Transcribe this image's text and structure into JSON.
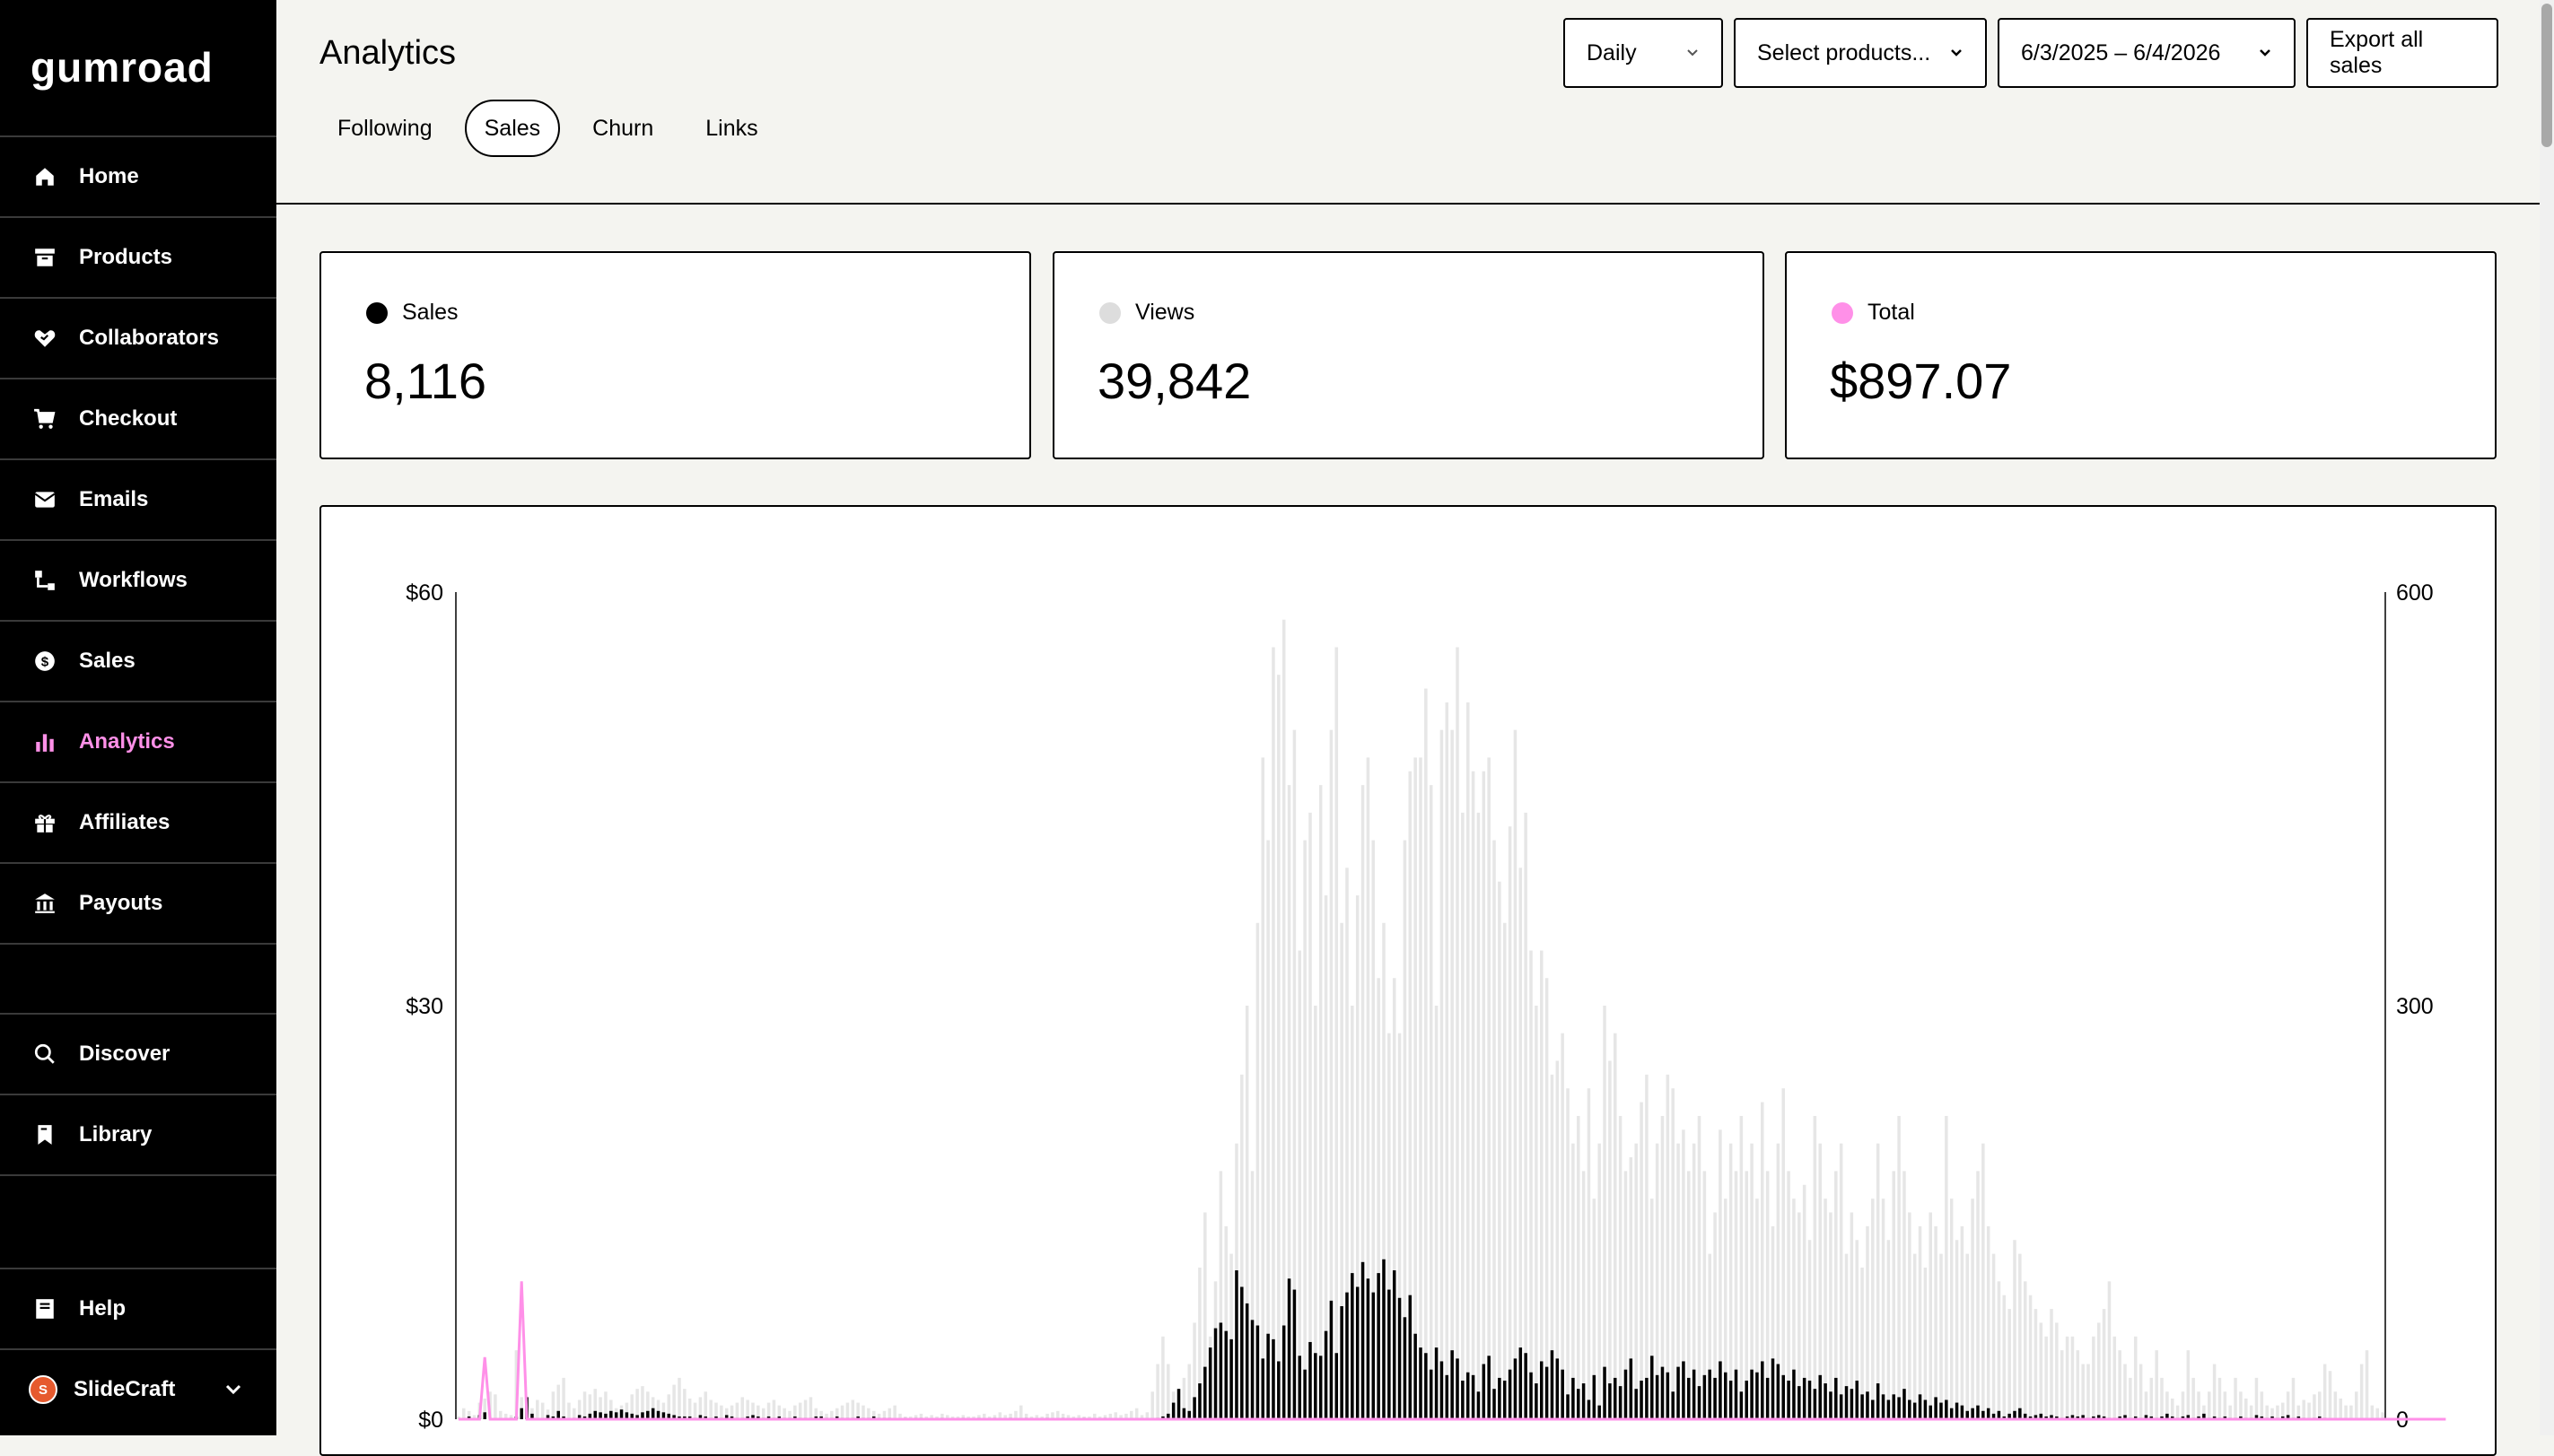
{
  "brand": {
    "logo_text": "gumroad"
  },
  "sidebar": {
    "items": [
      {
        "label": "Home",
        "icon": "home-icon"
      },
      {
        "label": "Products",
        "icon": "archive-icon"
      },
      {
        "label": "Collaborators",
        "icon": "handshake-icon"
      },
      {
        "label": "Checkout",
        "icon": "cart-icon"
      },
      {
        "label": "Emails",
        "icon": "envelope-icon"
      },
      {
        "label": "Workflows",
        "icon": "flow-icon"
      },
      {
        "label": "Sales",
        "icon": "dollar-circle-icon"
      },
      {
        "label": "Analytics",
        "icon": "bar-chart-icon",
        "active": true
      },
      {
        "label": "Affiliates",
        "icon": "gift-icon"
      },
      {
        "label": "Payouts",
        "icon": "bank-icon"
      }
    ],
    "secondary": [
      {
        "label": "Discover",
        "icon": "search-icon"
      },
      {
        "label": "Library",
        "icon": "bookmark-icon"
      }
    ],
    "help_label": "Help",
    "account": {
      "name": "SlideCraft",
      "avatar_letter": "S"
    }
  },
  "header": {
    "title": "Analytics",
    "tabs": [
      {
        "label": "Following",
        "active": false
      },
      {
        "label": "Sales",
        "active": true
      },
      {
        "label": "Churn",
        "active": false
      },
      {
        "label": "Links",
        "active": false
      }
    ],
    "interval_select": "Daily",
    "product_select": "Select products...",
    "date_range": "6/3/2025 – 6/4/2026",
    "export_label": "Export all sales"
  },
  "stats": [
    {
      "label": "Sales",
      "value": "8,116",
      "color": "#000000"
    },
    {
      "label": "Views",
      "value": "39,842",
      "color": "#dddddd"
    },
    {
      "label": "Total",
      "value": "$897.07",
      "color": "#ff90e8"
    }
  ],
  "colors": {
    "accent": "#ff90e8",
    "views": "#e6e6e6",
    "sales": "#000000"
  },
  "chart_data": {
    "type": "bar",
    "left_axis": {
      "ticks": [
        "$0",
        "$30",
        "$60"
      ],
      "ylim": [
        0,
        60
      ]
    },
    "right_axis": {
      "ticks": [
        "0",
        "300",
        "600"
      ],
      "ylim": [
        0,
        600
      ]
    },
    "x": "daily, 6/3/2025 – 6/4/2026 (367 days)",
    "series": [
      {
        "name": "Views",
        "type": "bar",
        "axis": "right",
        "color": "#e6e6e6",
        "values": [
          2,
          8,
          6,
          3,
          12,
          15,
          20,
          18,
          6,
          4,
          3,
          50,
          16,
          10,
          8,
          14,
          12,
          7,
          20,
          25,
          30,
          12,
          8,
          14,
          20,
          18,
          22,
          16,
          20,
          14,
          8,
          10,
          12,
          18,
          22,
          24,
          20,
          16,
          14,
          12,
          18,
          25,
          30,
          22,
          15,
          12,
          16,
          20,
          14,
          12,
          10,
          8,
          10,
          12,
          16,
          14,
          12,
          10,
          8,
          12,
          14,
          10,
          8,
          6,
          10,
          12,
          14,
          16,
          8,
          6,
          4,
          6,
          8,
          10,
          12,
          14,
          12,
          10,
          8,
          6,
          4,
          6,
          8,
          10,
          4,
          2,
          2,
          3,
          4,
          2,
          3,
          2,
          4,
          3,
          2,
          2,
          3,
          2,
          2,
          3,
          4,
          2,
          3,
          5,
          3,
          4,
          6,
          10,
          4,
          2,
          3,
          2,
          4,
          5,
          6,
          4,
          3,
          2,
          3,
          2,
          2,
          4,
          2,
          3,
          4,
          5,
          3,
          4,
          6,
          8,
          3,
          5,
          20,
          40,
          60,
          40,
          20,
          10,
          30,
          40,
          70,
          110,
          150,
          60,
          100,
          180,
          140,
          120,
          200,
          250,
          300,
          180,
          360,
          480,
          420,
          560,
          540,
          580,
          460,
          500,
          340,
          420,
          440,
          300,
          460,
          380,
          500,
          560,
          360,
          400,
          300,
          380,
          460,
          480,
          420,
          320,
          360,
          280,
          320,
          280,
          420,
          470,
          480,
          480,
          530,
          460,
          300,
          500,
          520,
          500,
          560,
          440,
          520,
          470,
          440,
          470,
          480,
          420,
          390,
          360,
          430,
          500,
          400,
          440,
          340,
          300,
          340,
          320,
          250,
          260,
          280,
          240,
          200,
          220,
          180,
          240,
          160,
          200,
          300,
          260,
          280,
          220,
          180,
          190,
          200,
          230,
          250,
          160,
          200,
          220,
          250,
          240,
          200,
          210,
          180,
          200,
          220,
          180,
          120,
          150,
          210,
          160,
          200,
          180,
          220,
          180,
          200,
          160,
          230,
          180,
          140,
          200,
          240,
          180,
          160,
          150,
          170,
          130,
          220,
          200,
          160,
          150,
          180,
          200,
          120,
          150,
          130,
          110,
          140,
          160,
          200,
          160,
          130,
          180,
          220,
          180,
          150,
          120,
          140,
          110,
          150,
          140,
          120,
          220,
          160,
          130,
          140,
          120,
          160,
          180,
          200,
          140,
          120,
          100,
          90,
          80,
          130,
          120,
          100,
          90,
          80,
          70,
          60,
          80,
          70,
          50,
          60,
          60,
          50,
          40,
          40,
          60,
          70,
          80,
          100,
          60,
          50,
          40,
          30,
          60,
          40,
          20,
          30,
          50,
          30,
          20,
          15,
          10,
          20,
          50,
          30,
          20,
          10,
          20,
          40,
          30,
          20,
          10,
          30,
          20,
          15,
          10,
          30,
          20,
          10,
          8,
          10,
          12,
          20,
          30,
          10,
          14,
          12,
          18,
          20,
          40,
          35,
          20,
          15,
          10,
          10,
          20,
          40,
          50,
          10,
          8,
          5
        ]
      },
      {
        "name": "Sales",
        "type": "bar",
        "axis": "left",
        "color": "#000000",
        "values": [
          0,
          0,
          0.2,
          0,
          0.3,
          0.5,
          0,
          0,
          0,
          0,
          0.1,
          0.2,
          0.8,
          1.6,
          0.4,
          0,
          0,
          0.3,
          0.2,
          0.6,
          0.2,
          0,
          0.1,
          0.3,
          0.2,
          0.4,
          0.6,
          0.5,
          0.4,
          0.6,
          0.5,
          0.7,
          0.5,
          0.4,
          0.3,
          0.5,
          0.6,
          0.8,
          0.6,
          0.5,
          0.4,
          0.3,
          0.2,
          0.2,
          0.2,
          0.1,
          0.3,
          0.2,
          0.1,
          0.2,
          0.1,
          0.3,
          0.2,
          0.1,
          0.1,
          0.2,
          0.3,
          0.2,
          0.1,
          0.2,
          0.1,
          0.2,
          0.1,
          0.1,
          0.2,
          0.1,
          0.1,
          0.1,
          0.2,
          0.2,
          0.1,
          0.1,
          0.2,
          0.1,
          0.1,
          0.1,
          0.2,
          0.1,
          0.1,
          0.2,
          0.1,
          0.1,
          0.1,
          0,
          0,
          0.1,
          0,
          0.1,
          0.1,
          0,
          0,
          0,
          0.1,
          0,
          0,
          0,
          0.1,
          0,
          0,
          0.1,
          0,
          0,
          0.1,
          0,
          0,
          0.1,
          0,
          0,
          0.1,
          0,
          0,
          0,
          0.1,
          0,
          0,
          0.1,
          0,
          0,
          0,
          0.1,
          0,
          0,
          0,
          0.1,
          0,
          0,
          0,
          0,
          0,
          0,
          0,
          0,
          0,
          0.1,
          0.2,
          0.4,
          1.2,
          2.2,
          0.8,
          0.6,
          1.6,
          2.6,
          3.8,
          5.2,
          6.6,
          7.0,
          6.4,
          5.8,
          10.8,
          9.6,
          8.4,
          7.2,
          6.8,
          4.4,
          6.2,
          5.8,
          4.2,
          6.8,
          10.2,
          9.4,
          4.6,
          3.6,
          5.6,
          4.8,
          4.6,
          6.4,
          8.6,
          4.8,
          8.2,
          9.2,
          10.6,
          9.6,
          11.4,
          10.2,
          9.2,
          10.6,
          11.6,
          9.4,
          10.8,
          8.8,
          7.4,
          9.0,
          6.2,
          5.2,
          4.8,
          3.6,
          5.2,
          4.2,
          3.2,
          5.0,
          4.4,
          2.8,
          3.4,
          3.2,
          2.0,
          4.0,
          4.6,
          2.2,
          3.0,
          2.8,
          3.6,
          4.4,
          5.2,
          4.8,
          3.4,
          2.6,
          4.2,
          3.8,
          5.0,
          4.4,
          3.6,
          1.8,
          3.0,
          2.2,
          2.6,
          1.4,
          3.2,
          1.0,
          3.8,
          2.6,
          3.0,
          2.4,
          3.6,
          4.4,
          2.2,
          2.8,
          3.0,
          4.6,
          3.2,
          3.8,
          3.4,
          2.0,
          3.8,
          4.2,
          3.0,
          3.6,
          2.4,
          3.2,
          3.6,
          3.0,
          4.2,
          3.4,
          2.8,
          3.6,
          2.0,
          2.8,
          3.6,
          3.4,
          4.2,
          3.0,
          4.4,
          4.0,
          3.2,
          2.8,
          3.6,
          2.4,
          3.0,
          2.8,
          2.2,
          3.2,
          2.6,
          2.0,
          3.0,
          1.8,
          2.4,
          2.2,
          2.8,
          1.8,
          2.0,
          1.4,
          2.6,
          1.8,
          1.4,
          1.8,
          1.6,
          2.2,
          1.4,
          1.2,
          1.8,
          1.4,
          1.0,
          1.6,
          1.2,
          1.4,
          0.8,
          1.2,
          1.0,
          0.6,
          0.8,
          1.0,
          0.6,
          0.8,
          0.4,
          0.6,
          0.2,
          0.4,
          0.6,
          0.8,
          0.4,
          0.2,
          0.3,
          0.4,
          0.2,
          0.3,
          0.2,
          0.1,
          0.2,
          0.3,
          0.2,
          0.3,
          0.1,
          0.2,
          0.3,
          0.2,
          0.1,
          0.1,
          0.2,
          0.3,
          0.1,
          0.2,
          0.1,
          0.3,
          0.2,
          0.1,
          0.2,
          0.4,
          0.2,
          0.1,
          0.2,
          0.3,
          0.1,
          0.2,
          0.4,
          0.1,
          0.2,
          0.1,
          0.2,
          0.1,
          0.1,
          0.2,
          0.1,
          0.1,
          0.3,
          0.2,
          0.1,
          0.2,
          0.1,
          0.2,
          0.3,
          0.1,
          0.2,
          0.1,
          0,
          0.1,
          0.2,
          0.1
        ]
      },
      {
        "name": "Total",
        "type": "line",
        "axis": "left",
        "color": "#ff90e8",
        "values": [
          0,
          0,
          0,
          0,
          0,
          4.5,
          0,
          0,
          0,
          0,
          0,
          0,
          10,
          0,
          0,
          0,
          0,
          0,
          0,
          0,
          0,
          0,
          0,
          0,
          0,
          0,
          0,
          0,
          0,
          0,
          0,
          0,
          0,
          0,
          0,
          0,
          0,
          0,
          0,
          0,
          0,
          0,
          0,
          0,
          0,
          0,
          0,
          0,
          0,
          0,
          0,
          0,
          0,
          0,
          0,
          0,
          0,
          0,
          0,
          0,
          0,
          0,
          0,
          0,
          0,
          0,
          0,
          0,
          0,
          0,
          0,
          0,
          0,
          0,
          0,
          0,
          0,
          0,
          0,
          0,
          0,
          0,
          0,
          0,
          0,
          0,
          0,
          0,
          0,
          0,
          0,
          0,
          0,
          0,
          0,
          0,
          0,
          0,
          0,
          0,
          0,
          0,
          0,
          0,
          0,
          0,
          0,
          0,
          0,
          0,
          0,
          0,
          0,
          0,
          0,
          0,
          0,
          0,
          0,
          0,
          0,
          0,
          0,
          0,
          0,
          0,
          0,
          0,
          0,
          0,
          0,
          0,
          0,
          0,
          0,
          0,
          0,
          0,
          0,
          0,
          0,
          0,
          0,
          0,
          0,
          0,
          0,
          0,
          0,
          0,
          0,
          0,
          0,
          0,
          0,
          0,
          0,
          0,
          0,
          0,
          0,
          0,
          0,
          0,
          0,
          0,
          0,
          0,
          0,
          0,
          0,
          0,
          0,
          0,
          0,
          0,
          0,
          0,
          0,
          0,
          0,
          0,
          0,
          0,
          0,
          0,
          0,
          0,
          0,
          0,
          0,
          0,
          0,
          0,
          0,
          0,
          0,
          0,
          0,
          0,
          0,
          0,
          0,
          0,
          0,
          0,
          0,
          0,
          0,
          0,
          0,
          0,
          0,
          0,
          0,
          0,
          0,
          0,
          0,
          0,
          0,
          0,
          0,
          0,
          0,
          0,
          0,
          0,
          0,
          0,
          0,
          0,
          0,
          0,
          0,
          0,
          0,
          0,
          0,
          0,
          0,
          0,
          0,
          0,
          0,
          0,
          0,
          0,
          0,
          0,
          0,
          0,
          0,
          0,
          0,
          0,
          0,
          0,
          0,
          0,
          0,
          0,
          0,
          0,
          0,
          0,
          0,
          0,
          0,
          0,
          0,
          0,
          0,
          0,
          0,
          0,
          0,
          0,
          0,
          0,
          0,
          0,
          0,
          0,
          0,
          0,
          0,
          0,
          0,
          0,
          0,
          0,
          0,
          0,
          0,
          0,
          0,
          0,
          0,
          0,
          0,
          0,
          0,
          0,
          0,
          0,
          0,
          0,
          0,
          0,
          0,
          0,
          0,
          0,
          0,
          0,
          0,
          0,
          0,
          0,
          0,
          0,
          0,
          0,
          0,
          0,
          0,
          0,
          0,
          0,
          0,
          0,
          0,
          0,
          0,
          0,
          0,
          0,
          0,
          0,
          0,
          0,
          0,
          0,
          0,
          0,
          0,
          0,
          0,
          0,
          0,
          0,
          0,
          0,
          0,
          0,
          0,
          0,
          0,
          0,
          0,
          0,
          0,
          0,
          0,
          0,
          0,
          0,
          0,
          0,
          0,
          0,
          0,
          0,
          0,
          0,
          0,
          0,
          0
        ]
      }
    ],
    "grid": false,
    "legend": "none"
  }
}
